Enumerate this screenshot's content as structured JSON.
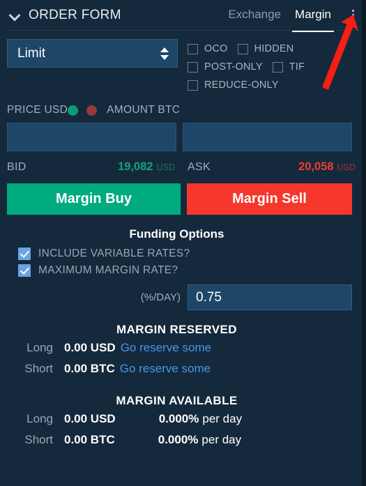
{
  "header": {
    "collapse_icon": "chevron-down-icon",
    "title": "ORDER FORM",
    "tabs": [
      {
        "label": "Exchange",
        "active": false
      },
      {
        "label": "Margin",
        "active": true
      }
    ],
    "menu_icon": "kebab-menu-icon"
  },
  "order_type": {
    "selected": "Limit",
    "spinner_icon": "updown-spinner-icon"
  },
  "flags": [
    {
      "label": "OCO",
      "checked": false
    },
    {
      "label": "HIDDEN",
      "checked": false
    },
    {
      "label": "POST-ONLY",
      "checked": false
    },
    {
      "label": "TIF",
      "checked": false
    },
    {
      "label": "REDUCE-ONLY",
      "checked": false
    }
  ],
  "price_amount": {
    "price_label": "PRICE USD",
    "amount_label": "AMOUNT BTC",
    "price_value": "",
    "amount_value": "",
    "price_placeholder": "",
    "amount_placeholder": "",
    "dot_green": "#0f9a77",
    "dot_red": "#99393f"
  },
  "book": {
    "bid_label": "BID",
    "bid_value": "19,082",
    "bid_currency": "USD",
    "bid_color": "#12a37c",
    "ask_label": "ASK",
    "ask_value": "20,058",
    "ask_currency": "USD",
    "ask_color": "#f5372c"
  },
  "actions": {
    "buy_label": "Margin Buy",
    "sell_label": "Margin Sell",
    "buy_color": "#00ab7f",
    "sell_color": "#f5372c"
  },
  "funding": {
    "title": "Funding Options",
    "options": [
      {
        "label": "INCLUDE VARIABLE RATES?",
        "checked": true
      },
      {
        "label": "MAXIMUM MARGIN RATE?",
        "checked": true
      }
    ],
    "rate_label": "(%/DAY)",
    "rate_value": "0.75",
    "rate_placeholder": ""
  },
  "margin_reserved": {
    "title": "MARGIN RESERVED",
    "rows": [
      {
        "side": "Long",
        "amount": "0.00 USD",
        "link": "Go reserve some"
      },
      {
        "side": "Short",
        "amount": "0.00 BTC",
        "link": "Go reserve some"
      }
    ]
  },
  "margin_available": {
    "title": "MARGIN AVAILABLE",
    "rows": [
      {
        "side": "Long",
        "amount": "0.00 USD",
        "rate": "0.000%",
        "suffix": "per day"
      },
      {
        "side": "Short",
        "amount": "0.00 BTC",
        "rate": "0.000%",
        "suffix": "per day"
      }
    ]
  },
  "annotation": {
    "type": "arrow",
    "color": "#f61f14",
    "points_to": "kebab-menu-icon"
  }
}
